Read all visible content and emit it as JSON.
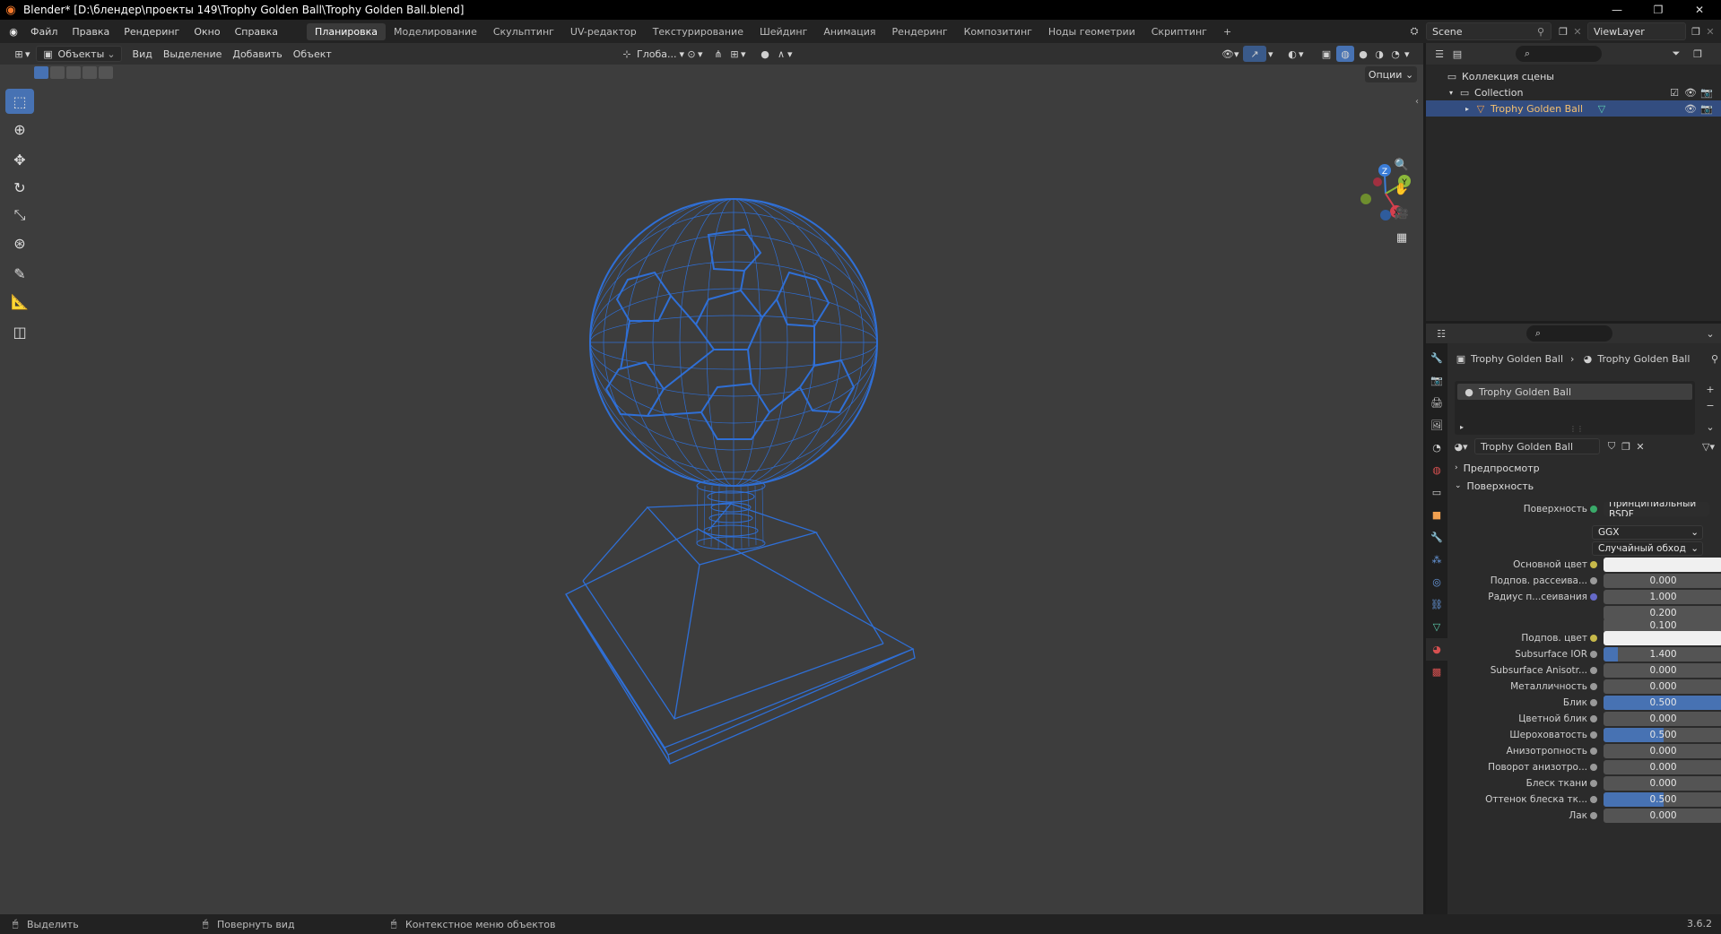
{
  "window": {
    "title": "Blender* [D:\\блендер\\проекты 149\\Trophy Golden Ball\\Trophy Golden Ball.blend]"
  },
  "menus": [
    "Файл",
    "Правка",
    "Рендеринг",
    "Окно",
    "Справка"
  ],
  "workspaces": [
    "Планировка",
    "Моделирование",
    "Скульптинг",
    "UV-редактор",
    "Текстурирование",
    "Шейдинг",
    "Анимация",
    "Рендеринг",
    "Композитинг",
    "Ноды геометрии",
    "Скриптинг"
  ],
  "active_workspace": "Планировка",
  "scene": {
    "name": "Scene",
    "view_layer": "ViewLayer"
  },
  "viewport_header": {
    "mode": "Объекты",
    "menus": [
      "Вид",
      "Выделение",
      "Добавить",
      "Объект"
    ],
    "transform_orientation": "Глоба...",
    "options_label": "Опции"
  },
  "outliner": {
    "root": "Коллекция сцены",
    "collection": "Collection",
    "object": "Trophy Golden Ball"
  },
  "properties": {
    "breadcrumb_object": "Trophy Golden Ball",
    "breadcrumb_material": "Trophy Golden Ball",
    "material_slot": "Trophy Golden Ball",
    "material_name": "Trophy Golden Ball",
    "section_preview": "Предпросмотр",
    "section_surface": "Поверхность",
    "surface_label": "Поверхность",
    "surface_value": "Принципиальный BSDF",
    "distribution": "GGX",
    "subsurface_method": "Случайный обход",
    "rows": [
      {
        "label": "Основной цвет",
        "type": "color",
        "color": "#f0f0f0"
      },
      {
        "label": "Подпов. рассеива...",
        "value": "0.000",
        "fill": 0
      },
      {
        "label": "Радиус п...сеивания",
        "value": "1.000",
        "fill": 0
      },
      {
        "label": "",
        "value": "0.200",
        "fill": 0
      },
      {
        "label": "",
        "value": "0.100",
        "fill": 0
      },
      {
        "label": "Подпов. цвет",
        "type": "color",
        "color": "#f0f0f0"
      },
      {
        "label": "Subsurface IOR",
        "value": "1.400",
        "fill": 0.12
      },
      {
        "label": "Subsurface Anisotr...",
        "value": "0.000",
        "fill": 0
      },
      {
        "label": "Металличность",
        "value": "0.000",
        "fill": 0
      },
      {
        "label": "Блик",
        "value": "0.500",
        "fill": 1.0
      },
      {
        "label": "Цветной блик",
        "value": "0.000",
        "fill": 0
      },
      {
        "label": "Шероховатость",
        "value": "0.500",
        "fill": 0.5
      },
      {
        "label": "Анизотропность",
        "value": "0.000",
        "fill": 0
      },
      {
        "label": "Поворот анизотро...",
        "value": "0.000",
        "fill": 0
      },
      {
        "label": "Блеск ткани",
        "value": "0.000",
        "fill": 0
      },
      {
        "label": "Оттенок блеска тк...",
        "value": "0.500",
        "fill": 0.5
      },
      {
        "label": "Лак",
        "value": "0.000",
        "fill": 0
      }
    ]
  },
  "statusbar": {
    "select": "Выделить",
    "rotate": "Повернуть вид",
    "context": "Контекстное меню объектов",
    "version": "3.6.2"
  },
  "colors": {
    "accent": "#4772b3",
    "wire": "#2f6fd6",
    "viewport_bg": "#3d3d3d"
  }
}
